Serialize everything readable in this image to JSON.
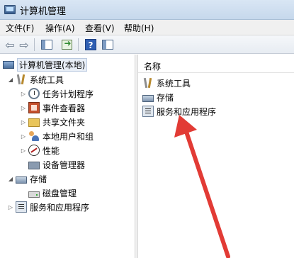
{
  "window": {
    "title": "计算机管理"
  },
  "menu": {
    "items": [
      {
        "label": "文件(F)"
      },
      {
        "label": "操作(A)"
      },
      {
        "label": "查看(V)"
      },
      {
        "label": "帮助(H)"
      }
    ]
  },
  "toolbar": {
    "icons": [
      "back-arrow-icon",
      "forward-arrow-icon",
      "show-tree-icon",
      "export-icon",
      "help-icon",
      "view-icon"
    ],
    "help_glyph": "?"
  },
  "tree": {
    "root": "计算机管理(本地)",
    "system_tools": "系统工具",
    "task_scheduler": "任务计划程序",
    "event_viewer": "事件查看器",
    "shared_folders": "共享文件夹",
    "local_users": "本地用户和组",
    "performance": "性能",
    "device_manager": "设备管理器",
    "storage": "存储",
    "disk_management": "磁盘管理",
    "services_apps": "服务和应用程序"
  },
  "list": {
    "column_name": "名称",
    "items": [
      {
        "label": "系统工具",
        "icon": "tools-icon"
      },
      {
        "label": "存储",
        "icon": "storage-icon"
      },
      {
        "label": "服务和应用程序",
        "icon": "services-icon"
      }
    ]
  },
  "colors": {
    "annotation_arrow": "#e23b35",
    "titlebar": "#cfdff0"
  }
}
